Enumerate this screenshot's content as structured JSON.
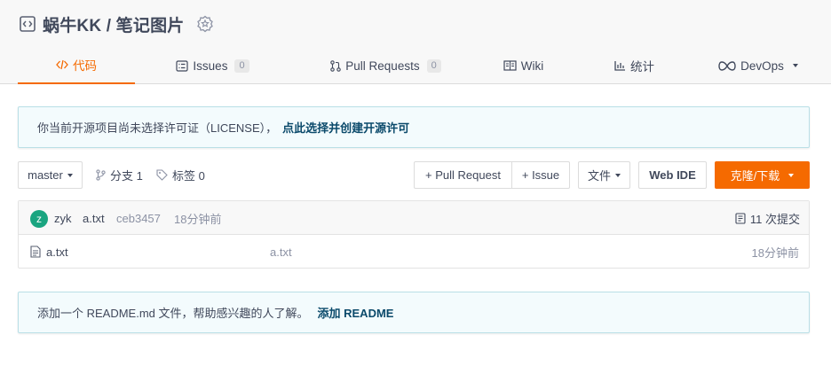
{
  "repo": {
    "title": "蜗牛KK / 笔记图片"
  },
  "tabs": [
    {
      "label": "代码"
    },
    {
      "label": "Issues",
      "count": "0"
    },
    {
      "label": "Pull Requests",
      "count": "0"
    },
    {
      "label": "Wiki"
    },
    {
      "label": "统计"
    },
    {
      "label": "DevOps"
    }
  ],
  "license_notice": {
    "text": "你当前开源项目尚未选择许可证（LICENSE），",
    "link": "点此选择并创建开源许可"
  },
  "toolbar": {
    "branch": "master",
    "branches_label": "分支 1",
    "tags_label": "标签 0",
    "pull_request": "+ Pull Request",
    "issue": "+ Issue",
    "file": "文件",
    "web_ide": "Web IDE",
    "clone": "克隆/下载"
  },
  "latest_commit": {
    "avatar_letter": "z",
    "author": "zyk",
    "message": "a.txt",
    "hash": "ceb3457",
    "time": "18分钟前",
    "commits_label": "11 次提交"
  },
  "files": [
    {
      "name": "a.txt",
      "message": "a.txt",
      "time": "18分钟前"
    }
  ],
  "readme_notice": {
    "text": "添加一个 README.md 文件，帮助感兴趣的人了解。",
    "link": "添加 README"
  },
  "colors": {
    "accent": "#f56a00",
    "link": "#0b4a6b",
    "notice_bg": "#f3fbfd",
    "avatar": "#1aa580"
  }
}
